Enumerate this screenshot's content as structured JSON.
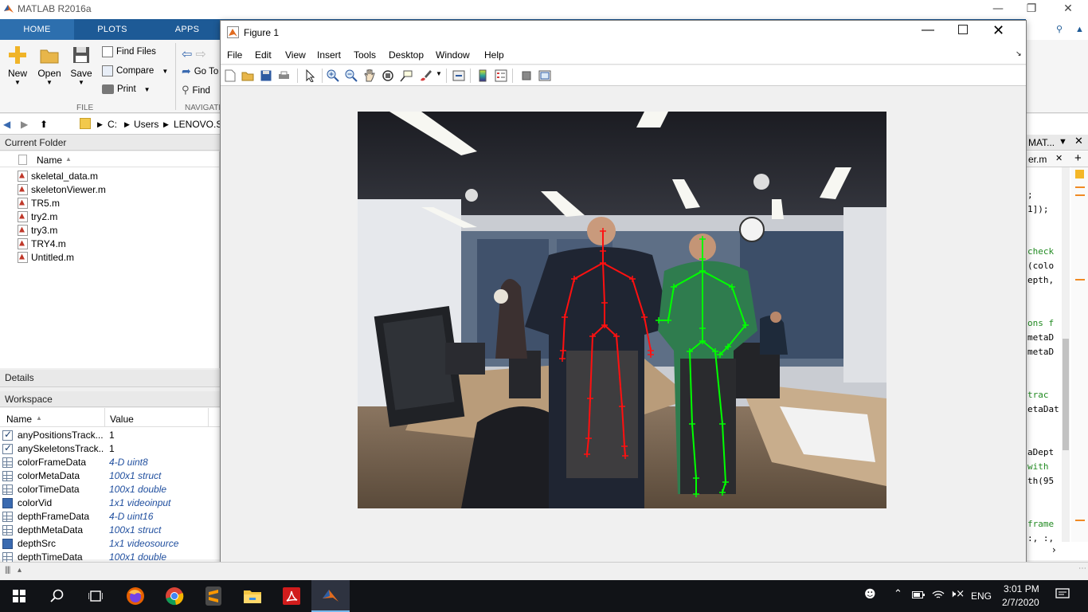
{
  "matlab": {
    "title": "MATLAB R2016a",
    "tabs": [
      "HOME",
      "PLOTS",
      "APPS"
    ],
    "ribbon": {
      "new": "New",
      "open": "Open",
      "save": "Save",
      "find_files": "Find Files",
      "compare": "Compare",
      "print": "Print",
      "go_to": "Go To",
      "find": "Find",
      "file_section": "FILE",
      "navigate_section": "NAVIGATE"
    },
    "path": [
      "C:",
      "Users",
      "LENOVO.SZ"
    ],
    "current_folder": {
      "header": "Current Folder",
      "name_col": "Name",
      "files": [
        "skeletal_data.m",
        "skeletonViewer.m",
        "TR5.m",
        "try2.m",
        "try3.m",
        "TRY4.m",
        "Untitled.m"
      ]
    },
    "details_header": "Details",
    "workspace": {
      "header": "Workspace",
      "name_col": "Name",
      "value_col": "Value",
      "rows": [
        {
          "name": "anyPositionsTrack...",
          "value": "1",
          "icon": "check"
        },
        {
          "name": "anySkeletonsTrack...",
          "value": "1",
          "icon": "check"
        },
        {
          "name": "colorFrameData",
          "value": "4-D uint8",
          "icon": "grid"
        },
        {
          "name": "colorMetaData",
          "value": "100x1 struct",
          "icon": "grid"
        },
        {
          "name": "colorTimeData",
          "value": "100x1 double",
          "icon": "grid"
        },
        {
          "name": "colorVid",
          "value": "1x1 videoinput",
          "icon": "obj"
        },
        {
          "name": "depthFrameData",
          "value": "4-D uint16",
          "icon": "grid"
        },
        {
          "name": "depthMetaData",
          "value": "100x1 struct",
          "icon": "grid"
        },
        {
          "name": "depthSrc",
          "value": "1x1 videosource",
          "icon": "obj"
        },
        {
          "name": "depthTimeData",
          "value": "100x1 double",
          "icon": "grid"
        }
      ]
    },
    "editor": {
      "panel_title": "MAT...",
      "tab": "er.m",
      "code_lines": [
        {
          "text": ";",
          "comment": false
        },
        {
          "text": "1]);",
          "comment": false
        },
        {
          "text": " check",
          "comment": true
        },
        {
          "text": "(colo",
          "comment": false
        },
        {
          "text": "epth,",
          "comment": false
        },
        {
          "text": "ons f",
          "comment": true
        },
        {
          "text": "metaD",
          "comment": false
        },
        {
          "text": "metaD",
          "comment": false
        },
        {
          "text": " trac",
          "comment": true
        },
        {
          "text": "etaDat",
          "comment": false
        },
        {
          "text": "aDept",
          "comment": false
        },
        {
          "text": " with",
          "comment": true
        },
        {
          "text": "th(95",
          "comment": false
        },
        {
          "text": " frame",
          "comment": true
        },
        {
          "text": ":, :,",
          "comment": false
        }
      ]
    }
  },
  "figure": {
    "title": "Figure 1",
    "menus": [
      "File",
      "Edit",
      "View",
      "Insert",
      "Tools",
      "Desktop",
      "Window",
      "Help"
    ]
  },
  "taskbar": {
    "time": "3:01 PM",
    "date": "2/7/2020",
    "language": "ENG"
  }
}
